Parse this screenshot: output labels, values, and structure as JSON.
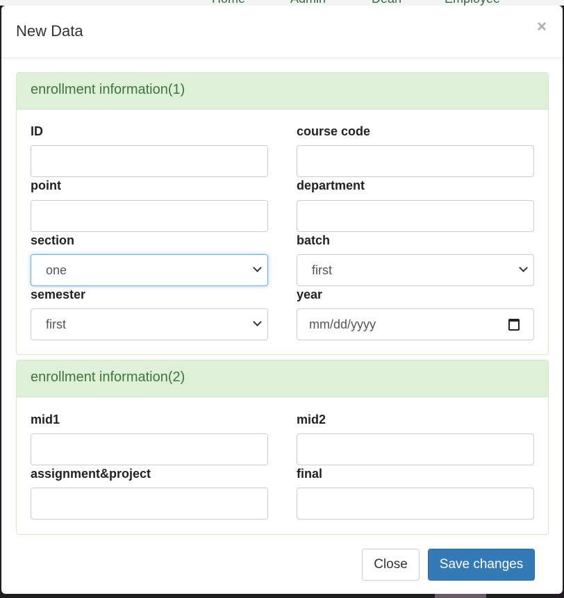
{
  "background_nav": [
    "Home",
    "Admin",
    "Dean",
    "Employee"
  ],
  "modal": {
    "title": "New Data",
    "close_glyph": "×",
    "panel1": {
      "heading": "enrollment information(1)",
      "fields": {
        "id": {
          "label": "ID",
          "value": ""
        },
        "course_code": {
          "label": "course code",
          "value": ""
        },
        "point": {
          "label": "point",
          "value": ""
        },
        "department": {
          "label": "department",
          "value": ""
        },
        "section": {
          "label": "section",
          "selected": "one"
        },
        "batch": {
          "label": "batch",
          "selected": "first"
        },
        "semester": {
          "label": "semester",
          "selected": "first"
        },
        "year": {
          "label": "year",
          "placeholder": "mm/dd/yyyy"
        }
      }
    },
    "panel2": {
      "heading": "enrollment information(2)",
      "fields": {
        "mid1": {
          "label": "mid1",
          "value": ""
        },
        "mid2": {
          "label": "mid2",
          "value": ""
        },
        "assignment_project": {
          "label": "assignment&project",
          "value": ""
        },
        "final": {
          "label": "final",
          "value": ""
        }
      }
    },
    "footer": {
      "close_label": "Close",
      "save_label": "Save changes"
    }
  },
  "colors": {
    "panel_heading_bg": "#dff0d8",
    "panel_heading_text": "#3c763d",
    "primary": "#337ab7",
    "focus": "#66afe9"
  }
}
